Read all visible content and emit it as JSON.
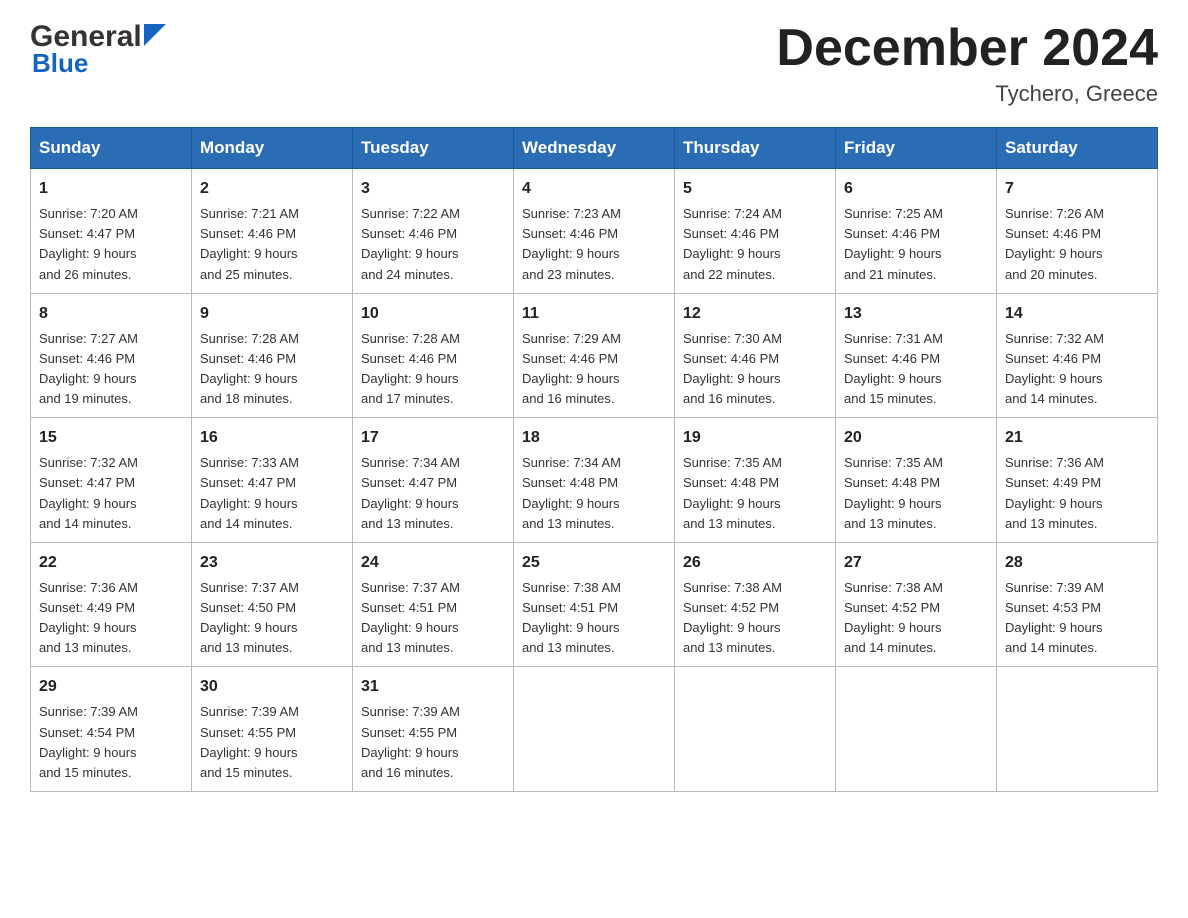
{
  "header": {
    "logo_general": "General",
    "logo_blue": "Blue",
    "title": "December 2024",
    "location": "Tychero, Greece"
  },
  "days_of_week": [
    "Sunday",
    "Monday",
    "Tuesday",
    "Wednesday",
    "Thursday",
    "Friday",
    "Saturday"
  ],
  "weeks": [
    [
      {
        "day": "1",
        "sunrise": "Sunrise: 7:20 AM",
        "sunset": "Sunset: 4:47 PM",
        "daylight": "Daylight: 9 hours",
        "daylight2": "and 26 minutes."
      },
      {
        "day": "2",
        "sunrise": "Sunrise: 7:21 AM",
        "sunset": "Sunset: 4:46 PM",
        "daylight": "Daylight: 9 hours",
        "daylight2": "and 25 minutes."
      },
      {
        "day": "3",
        "sunrise": "Sunrise: 7:22 AM",
        "sunset": "Sunset: 4:46 PM",
        "daylight": "Daylight: 9 hours",
        "daylight2": "and 24 minutes."
      },
      {
        "day": "4",
        "sunrise": "Sunrise: 7:23 AM",
        "sunset": "Sunset: 4:46 PM",
        "daylight": "Daylight: 9 hours",
        "daylight2": "and 23 minutes."
      },
      {
        "day": "5",
        "sunrise": "Sunrise: 7:24 AM",
        "sunset": "Sunset: 4:46 PM",
        "daylight": "Daylight: 9 hours",
        "daylight2": "and 22 minutes."
      },
      {
        "day": "6",
        "sunrise": "Sunrise: 7:25 AM",
        "sunset": "Sunset: 4:46 PM",
        "daylight": "Daylight: 9 hours",
        "daylight2": "and 21 minutes."
      },
      {
        "day": "7",
        "sunrise": "Sunrise: 7:26 AM",
        "sunset": "Sunset: 4:46 PM",
        "daylight": "Daylight: 9 hours",
        "daylight2": "and 20 minutes."
      }
    ],
    [
      {
        "day": "8",
        "sunrise": "Sunrise: 7:27 AM",
        "sunset": "Sunset: 4:46 PM",
        "daylight": "Daylight: 9 hours",
        "daylight2": "and 19 minutes."
      },
      {
        "day": "9",
        "sunrise": "Sunrise: 7:28 AM",
        "sunset": "Sunset: 4:46 PM",
        "daylight": "Daylight: 9 hours",
        "daylight2": "and 18 minutes."
      },
      {
        "day": "10",
        "sunrise": "Sunrise: 7:28 AM",
        "sunset": "Sunset: 4:46 PM",
        "daylight": "Daylight: 9 hours",
        "daylight2": "and 17 minutes."
      },
      {
        "day": "11",
        "sunrise": "Sunrise: 7:29 AM",
        "sunset": "Sunset: 4:46 PM",
        "daylight": "Daylight: 9 hours",
        "daylight2": "and 16 minutes."
      },
      {
        "day": "12",
        "sunrise": "Sunrise: 7:30 AM",
        "sunset": "Sunset: 4:46 PM",
        "daylight": "Daylight: 9 hours",
        "daylight2": "and 16 minutes."
      },
      {
        "day": "13",
        "sunrise": "Sunrise: 7:31 AM",
        "sunset": "Sunset: 4:46 PM",
        "daylight": "Daylight: 9 hours",
        "daylight2": "and 15 minutes."
      },
      {
        "day": "14",
        "sunrise": "Sunrise: 7:32 AM",
        "sunset": "Sunset: 4:46 PM",
        "daylight": "Daylight: 9 hours",
        "daylight2": "and 14 minutes."
      }
    ],
    [
      {
        "day": "15",
        "sunrise": "Sunrise: 7:32 AM",
        "sunset": "Sunset: 4:47 PM",
        "daylight": "Daylight: 9 hours",
        "daylight2": "and 14 minutes."
      },
      {
        "day": "16",
        "sunrise": "Sunrise: 7:33 AM",
        "sunset": "Sunset: 4:47 PM",
        "daylight": "Daylight: 9 hours",
        "daylight2": "and 14 minutes."
      },
      {
        "day": "17",
        "sunrise": "Sunrise: 7:34 AM",
        "sunset": "Sunset: 4:47 PM",
        "daylight": "Daylight: 9 hours",
        "daylight2": "and 13 minutes."
      },
      {
        "day": "18",
        "sunrise": "Sunrise: 7:34 AM",
        "sunset": "Sunset: 4:48 PM",
        "daylight": "Daylight: 9 hours",
        "daylight2": "and 13 minutes."
      },
      {
        "day": "19",
        "sunrise": "Sunrise: 7:35 AM",
        "sunset": "Sunset: 4:48 PM",
        "daylight": "Daylight: 9 hours",
        "daylight2": "and 13 minutes."
      },
      {
        "day": "20",
        "sunrise": "Sunrise: 7:35 AM",
        "sunset": "Sunset: 4:48 PM",
        "daylight": "Daylight: 9 hours",
        "daylight2": "and 13 minutes."
      },
      {
        "day": "21",
        "sunrise": "Sunrise: 7:36 AM",
        "sunset": "Sunset: 4:49 PM",
        "daylight": "Daylight: 9 hours",
        "daylight2": "and 13 minutes."
      }
    ],
    [
      {
        "day": "22",
        "sunrise": "Sunrise: 7:36 AM",
        "sunset": "Sunset: 4:49 PM",
        "daylight": "Daylight: 9 hours",
        "daylight2": "and 13 minutes."
      },
      {
        "day": "23",
        "sunrise": "Sunrise: 7:37 AM",
        "sunset": "Sunset: 4:50 PM",
        "daylight": "Daylight: 9 hours",
        "daylight2": "and 13 minutes."
      },
      {
        "day": "24",
        "sunrise": "Sunrise: 7:37 AM",
        "sunset": "Sunset: 4:51 PM",
        "daylight": "Daylight: 9 hours",
        "daylight2": "and 13 minutes."
      },
      {
        "day": "25",
        "sunrise": "Sunrise: 7:38 AM",
        "sunset": "Sunset: 4:51 PM",
        "daylight": "Daylight: 9 hours",
        "daylight2": "and 13 minutes."
      },
      {
        "day": "26",
        "sunrise": "Sunrise: 7:38 AM",
        "sunset": "Sunset: 4:52 PM",
        "daylight": "Daylight: 9 hours",
        "daylight2": "and 13 minutes."
      },
      {
        "day": "27",
        "sunrise": "Sunrise: 7:38 AM",
        "sunset": "Sunset: 4:52 PM",
        "daylight": "Daylight: 9 hours",
        "daylight2": "and 14 minutes."
      },
      {
        "day": "28",
        "sunrise": "Sunrise: 7:39 AM",
        "sunset": "Sunset: 4:53 PM",
        "daylight": "Daylight: 9 hours",
        "daylight2": "and 14 minutes."
      }
    ],
    [
      {
        "day": "29",
        "sunrise": "Sunrise: 7:39 AM",
        "sunset": "Sunset: 4:54 PM",
        "daylight": "Daylight: 9 hours",
        "daylight2": "and 15 minutes."
      },
      {
        "day": "30",
        "sunrise": "Sunrise: 7:39 AM",
        "sunset": "Sunset: 4:55 PM",
        "daylight": "Daylight: 9 hours",
        "daylight2": "and 15 minutes."
      },
      {
        "day": "31",
        "sunrise": "Sunrise: 7:39 AM",
        "sunset": "Sunset: 4:55 PM",
        "daylight": "Daylight: 9 hours",
        "daylight2": "and 16 minutes."
      },
      null,
      null,
      null,
      null
    ]
  ]
}
